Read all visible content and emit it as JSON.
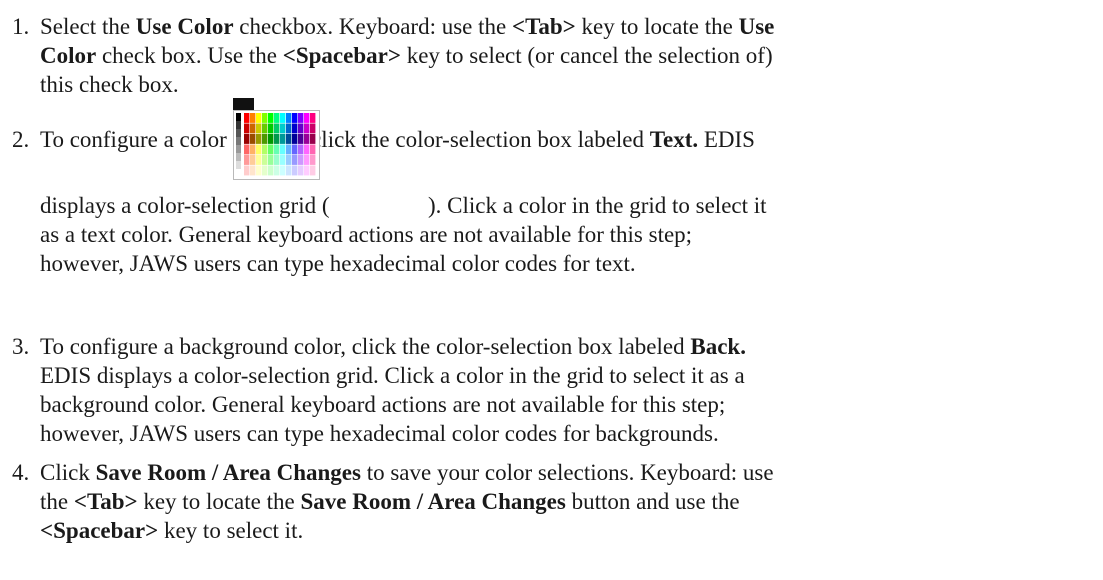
{
  "steps": [
    {
      "number": "1.",
      "lines": [
        [
          {
            "t": "Select the "
          },
          {
            "t": "Use Color",
            "b": true
          },
          {
            "t": " checkbox. Keyboard: use the "
          },
          {
            "t": "<Tab>",
            "b": true
          },
          {
            "t": " key to locate the "
          },
          {
            "t": "Use",
            "b": true
          }
        ],
        [
          {
            "t": "Color",
            "b": true
          },
          {
            "t": " check box. Use the "
          },
          {
            "t": "<Spacebar>",
            "b": true
          },
          {
            "t": " key to select (or cancel the selection of)"
          }
        ],
        [
          {
            "t": "this check box."
          }
        ]
      ]
    },
    {
      "number": "2.",
      "lines": [
        [
          {
            "t": "To configure a color for text, click the color-selection box labeled "
          },
          {
            "t": "Text.",
            "b": true
          },
          {
            "t": " EDIS"
          }
        ],
        [
          {
            "t": "displays a color-selection grid ( "
          },
          {
            "img": "color-grid"
          },
          {
            "t": " ). Click a color in the grid to select it"
          }
        ],
        [
          {
            "t": "as a text color. General keyboard actions are not available for this step;"
          }
        ],
        [
          {
            "t": "however, JAWS users can type hexadecimal color codes for text."
          }
        ]
      ]
    },
    {
      "number": "3.",
      "lines": [
        [
          {
            "t": "To configure a background color, click the color-selection box labeled "
          },
          {
            "t": "Back.",
            "b": true
          }
        ],
        [
          {
            "t": "EDIS displays a color-selection grid. Click a color in the grid to select it as a"
          }
        ],
        [
          {
            "t": "background color. General keyboard actions are not available for this step;"
          }
        ],
        [
          {
            "t": "however, JAWS users can type hexadecimal color codes for backgrounds."
          }
        ]
      ]
    },
    {
      "number": "4.",
      "lines": [
        [
          {
            "t": "Click "
          },
          {
            "t": "Save Room / Area Changes",
            "b": true
          },
          {
            "t": " to save your color selections. Keyboard: use"
          }
        ],
        [
          {
            "t": "the "
          },
          {
            "t": "<Tab>",
            "b": true
          },
          {
            "t": " key to locate the "
          },
          {
            "t": "Save Room / Area Changes",
            "b": true
          },
          {
            "t": " button and use the"
          }
        ],
        [
          {
            "t": "<Spacebar>",
            "b": true
          },
          {
            "t": " key to select it."
          }
        ]
      ]
    }
  ],
  "color_grid_colors": [
    [
      "#ff0000",
      "#ff7f00",
      "#ffff00",
      "#7fff00",
      "#00ff00",
      "#00ff7f",
      "#00ffff",
      "#007fff",
      "#0000ff",
      "#7f00ff",
      "#ff00ff",
      "#ff007f"
    ],
    [
      "#cc0000",
      "#cc6600",
      "#cccc00",
      "#66cc00",
      "#00cc00",
      "#00cc66",
      "#00cccc",
      "#0066cc",
      "#0000cc",
      "#6600cc",
      "#cc00cc",
      "#cc0066"
    ],
    [
      "#990000",
      "#994c00",
      "#999900",
      "#4c9900",
      "#009900",
      "#00994c",
      "#009999",
      "#004c99",
      "#000099",
      "#4c0099",
      "#990099",
      "#99004c"
    ],
    [
      "#ff6666",
      "#ffb266",
      "#ffff66",
      "#b2ff66",
      "#66ff66",
      "#66ffb2",
      "#66ffff",
      "#66b2ff",
      "#6666ff",
      "#b266ff",
      "#ff66ff",
      "#ff66b2"
    ],
    [
      "#ff9999",
      "#ffcc99",
      "#ffff99",
      "#ccff99",
      "#99ff99",
      "#99ffcc",
      "#99ffff",
      "#99ccff",
      "#9999ff",
      "#cc99ff",
      "#ff99ff",
      "#ff99cc"
    ],
    [
      "#ffcccc",
      "#ffe5cc",
      "#ffffcc",
      "#e5ffcc",
      "#ccffcc",
      "#ccffe5",
      "#ccffff",
      "#cce5ff",
      "#ccccff",
      "#e5ccff",
      "#ffccff",
      "#ffcce5"
    ]
  ]
}
